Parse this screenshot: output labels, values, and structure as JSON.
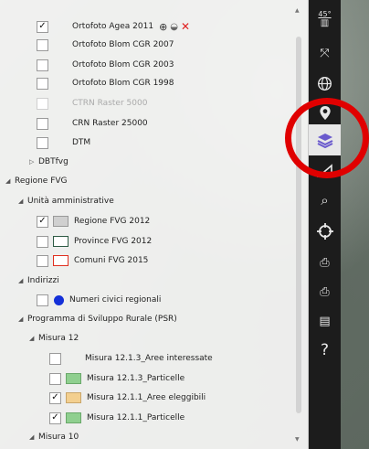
{
  "layers_panel": {
    "items": [
      {
        "label": "Ortofoto Agea 2011",
        "checked": true
      },
      {
        "label": "Ortofoto Blom CGR 2007",
        "checked": false
      },
      {
        "label": "Ortofoto Blom CGR 2003",
        "checked": false
      },
      {
        "label": "Ortofoto Blom CGR 1998",
        "checked": false
      },
      {
        "label": "CTRN Raster 5000",
        "checked": false,
        "disabled": true
      },
      {
        "label": "CRN Raster 25000",
        "checked": false
      },
      {
        "label": "DTM",
        "checked": false
      }
    ],
    "groups": {
      "dbtfvg": "DBTfvg",
      "regione": "Regione FVG",
      "unita": "Unità amministrative",
      "indirizzi": "Indirizzi",
      "psr": "Programma di Sviluppo Rurale (PSR)",
      "misura12": "Misura 12",
      "misura10": "Misura 10"
    },
    "unita_items": [
      {
        "label": "Regione FVG 2012",
        "checked": true,
        "color": "#d0d0d0"
      },
      {
        "label": "Province FVG 2012",
        "checked": false,
        "color": "#2e5b45"
      },
      {
        "label": "Comuni FVG 2015",
        "checked": false,
        "color": "#e03020"
      }
    ],
    "indirizzi_items": [
      {
        "label": "Numeri civici regionali",
        "checked": false,
        "color": "#1430d8"
      }
    ],
    "misura12_items": [
      {
        "label": "Misura 12.1.3_Aree interessate",
        "checked": false
      },
      {
        "label": "Misura 12.1.3_Particelle",
        "checked": false,
        "color": "#8fcf8f"
      },
      {
        "label": "Misura 12.1.1_Aree eleggibili",
        "checked": true,
        "color": "#f3cf8f"
      },
      {
        "label": "Misura 12.1.1_Particelle",
        "checked": true,
        "color": "#8fcf8f"
      }
    ],
    "check_mark": "✓"
  },
  "toolbar": {
    "rotate_label": "45°",
    "items": [
      "fullscreen",
      "globe",
      "location",
      "layers",
      "measure",
      "search-place",
      "crosshair",
      "print-settings",
      "print-search",
      "document-search",
      "help"
    ],
    "help_label": "?"
  },
  "colors": {
    "highlight": "#e00000",
    "toolbar_bg": "#1c1c1c"
  }
}
